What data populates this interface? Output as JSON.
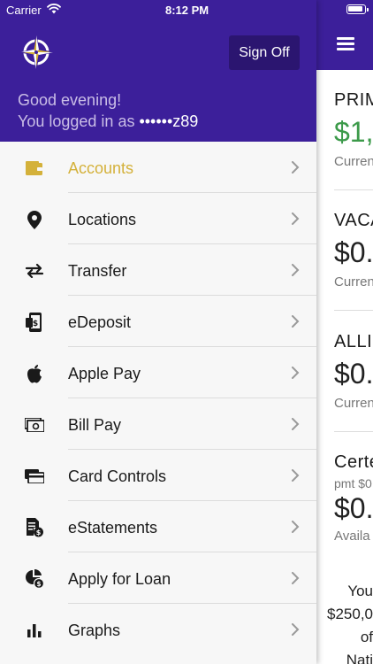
{
  "status": {
    "carrier": "Carrier",
    "time": "8:12 PM"
  },
  "header": {
    "signoff_label": "Sign Off",
    "greeting": "Good evening!",
    "logged_prefix": "You logged in as ",
    "masked_user": "••••••z89"
  },
  "menu": {
    "items": [
      {
        "label": "Accounts",
        "icon": "wallet-icon",
        "active": true
      },
      {
        "label": "Locations",
        "icon": "location-pin-icon"
      },
      {
        "label": "Transfer",
        "icon": "transfer-arrows-icon"
      },
      {
        "label": "eDeposit",
        "icon": "mobile-check-deposit-icon"
      },
      {
        "label": "Apple Pay",
        "icon": "apple-icon"
      },
      {
        "label": "Bill Pay",
        "icon": "money-bill-icon"
      },
      {
        "label": "Card Controls",
        "icon": "credit-card-icon"
      },
      {
        "label": "eStatements",
        "icon": "statement-icon"
      },
      {
        "label": "Apply for Loan",
        "icon": "loan-pie-icon"
      },
      {
        "label": "Graphs",
        "icon": "bar-chart-icon"
      }
    ]
  },
  "accounts": {
    "a1": {
      "name": "PRIM",
      "balance": "$1,",
      "sub": "Curren"
    },
    "a2": {
      "name": "VACA",
      "balance": "$0.",
      "sub": "Curren"
    },
    "a3": {
      "name": "ALLI",
      "balance": "$0.",
      "sub": "Curren"
    },
    "a4": {
      "name": "Certe",
      "pmt": "pmt $0",
      "balance": "$0.",
      "sub": "Availa"
    },
    "insurance": {
      "line1": "You",
      "line2": "$250,0",
      "line3": "of",
      "line4": "Nati"
    }
  },
  "colors": {
    "brand_purple": "#3c1f9a",
    "active_gold": "#d4b13a",
    "balance_green": "#3c9a4a"
  }
}
